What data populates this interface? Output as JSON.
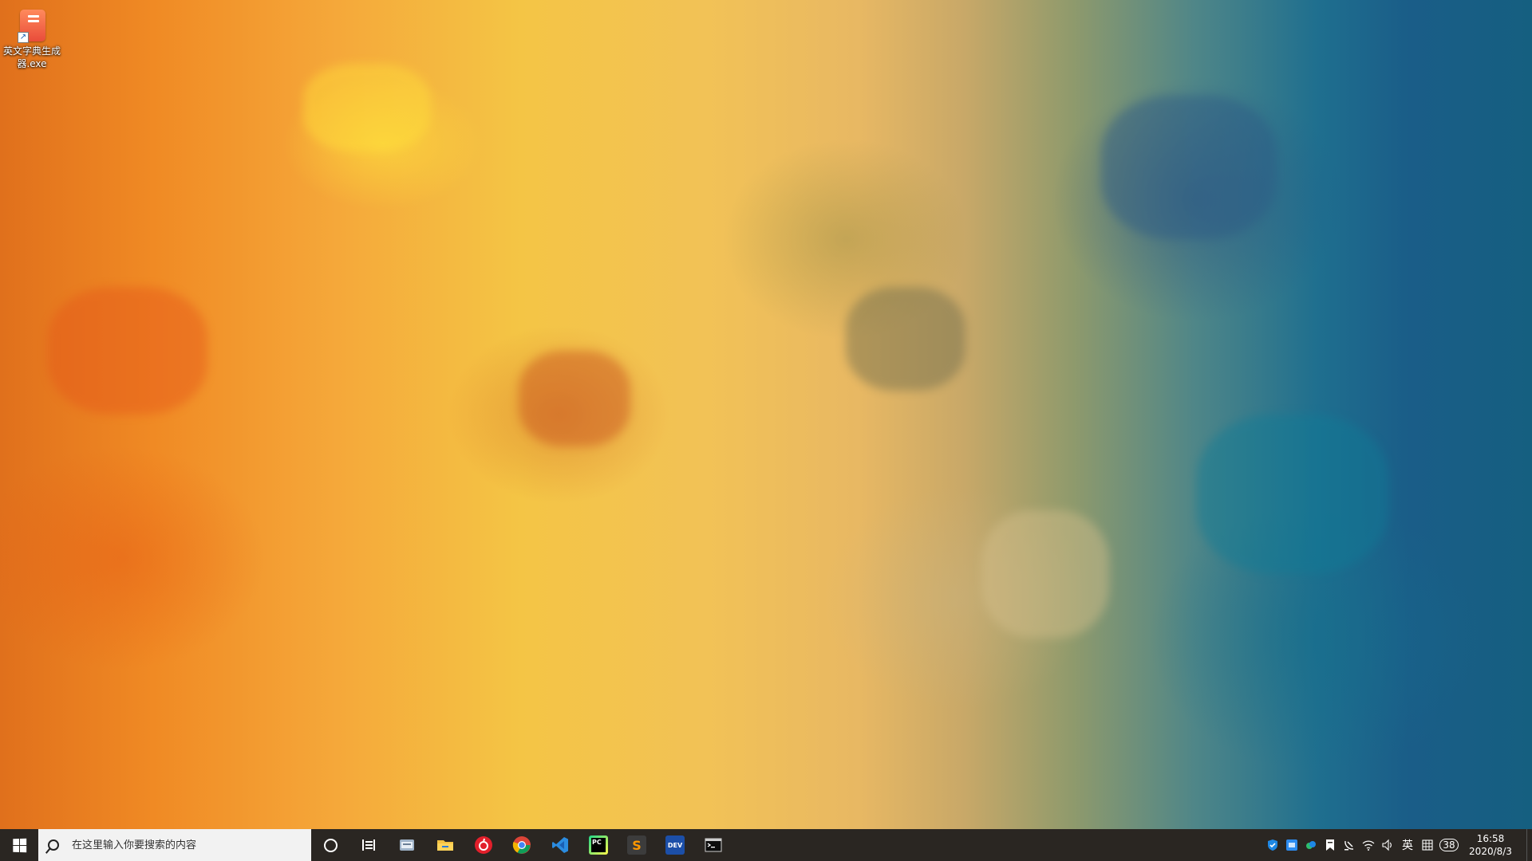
{
  "desktop": {
    "icons": [
      {
        "label": "英文字典生成器.exe",
        "icon": "dictionary-app-icon",
        "shortcut": true
      }
    ]
  },
  "taskbar": {
    "search": {
      "placeholder": "在这里输入你要搜索的内容"
    },
    "pinned_apps": [
      {
        "name": "file-manager-icon"
      },
      {
        "name": "file-explorer-icon"
      },
      {
        "name": "netease-music-icon"
      },
      {
        "name": "chrome-icon"
      },
      {
        "name": "vscode-icon"
      },
      {
        "name": "pycharm-icon",
        "text": "PC"
      },
      {
        "name": "sublime-text-icon",
        "text": "S"
      },
      {
        "name": "dev-cpp-icon",
        "text": "DEV"
      },
      {
        "name": "terminal-icon"
      }
    ],
    "tray": {
      "ime_label": "英",
      "badge": "38",
      "time": "16:58",
      "date": "2020/8/3"
    }
  }
}
